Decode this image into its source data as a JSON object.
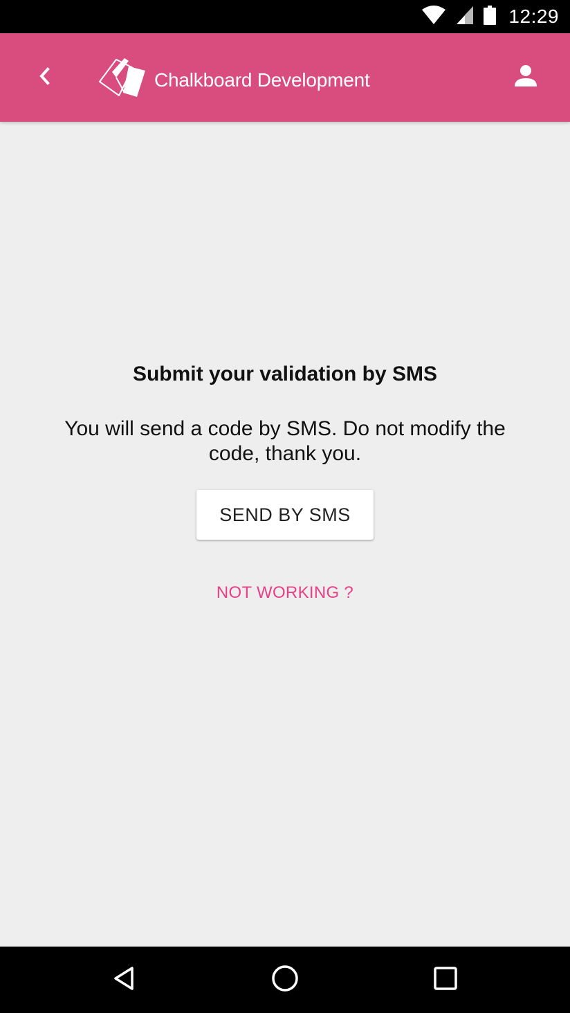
{
  "status_bar": {
    "time": "12:29",
    "icons": [
      "wifi-icon",
      "cell-signal-icon",
      "battery-icon"
    ]
  },
  "app_bar": {
    "title": "Chalkboard Development",
    "back_icon": "chevron-left-icon",
    "logo": "chalkboard-logo",
    "account_icon": "person-icon",
    "color": "#d94c7e"
  },
  "content": {
    "heading": "Submit your validation by SMS",
    "description": "You will send a code by SMS. Do not modify the code, thank you.",
    "send_button_label": "SEND BY SMS",
    "not_working_label": "NOT WORKING ?",
    "link_color": "#e93f86"
  },
  "nav_bar": {
    "icons": [
      "back-triangle-icon",
      "home-circle-icon",
      "recents-square-icon"
    ]
  }
}
